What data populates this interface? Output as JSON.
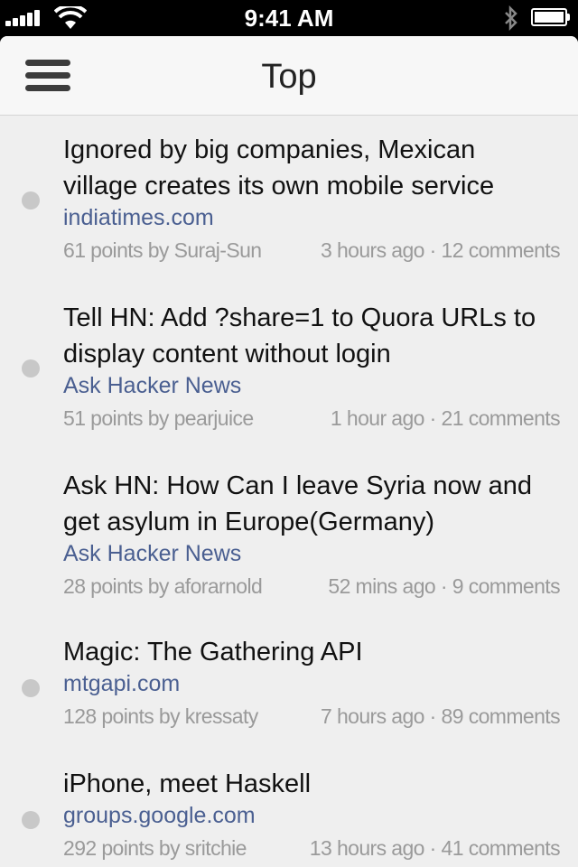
{
  "status_bar": {
    "time": "9:41 AM",
    "icons": [
      "signal-icon",
      "wifi-icon",
      "bluetooth-icon",
      "battery-icon"
    ]
  },
  "nav": {
    "title": "Top",
    "menu_icon": "hamburger-menu-icon"
  },
  "colors": {
    "background": "#efefef",
    "nav_background": "#f7f7f7",
    "domain_link": "#4a5f91",
    "meta_text": "#9a9a9a",
    "title_text": "#111111",
    "unread_dot": "#c8c8c8"
  },
  "stories": [
    {
      "title_lines": [
        "Ignored by big companies, Mexican",
        "village creates its own mobile service"
      ],
      "domain": "indiatimes.com",
      "points_by": "61 points by Suraj-Sun",
      "time": "3 hours ago",
      "separator": "·",
      "comments": "12 comments"
    },
    {
      "title_lines": [
        "Tell HN: Add ?share=1 to Quora URLs to",
        "display content without login"
      ],
      "domain": "Ask Hacker News",
      "points_by": "51 points by pearjuice",
      "time": "1 hour ago",
      "separator": "·",
      "comments": "21 comments"
    },
    {
      "title_lines": [
        "Ask HN: How Can I leave Syria now and",
        "get asylum in Europe(Germany)"
      ],
      "domain": "Ask Hacker News",
      "points_by": "28 points by aforarnold",
      "time": "52 mins ago",
      "separator": "·",
      "comments": "9 comments"
    },
    {
      "title_lines": [
        "Magic: The Gathering API"
      ],
      "domain": "mtgapi.com",
      "points_by": "128 points by kressaty",
      "time": "7 hours ago",
      "separator": "·",
      "comments": "89 comments"
    },
    {
      "title_lines": [
        "iPhone, meet Haskell"
      ],
      "domain": "groups.google.com",
      "points_by": "292 points by sritchie",
      "time": "13 hours ago",
      "separator": "·",
      "comments": "41 comments"
    }
  ]
}
